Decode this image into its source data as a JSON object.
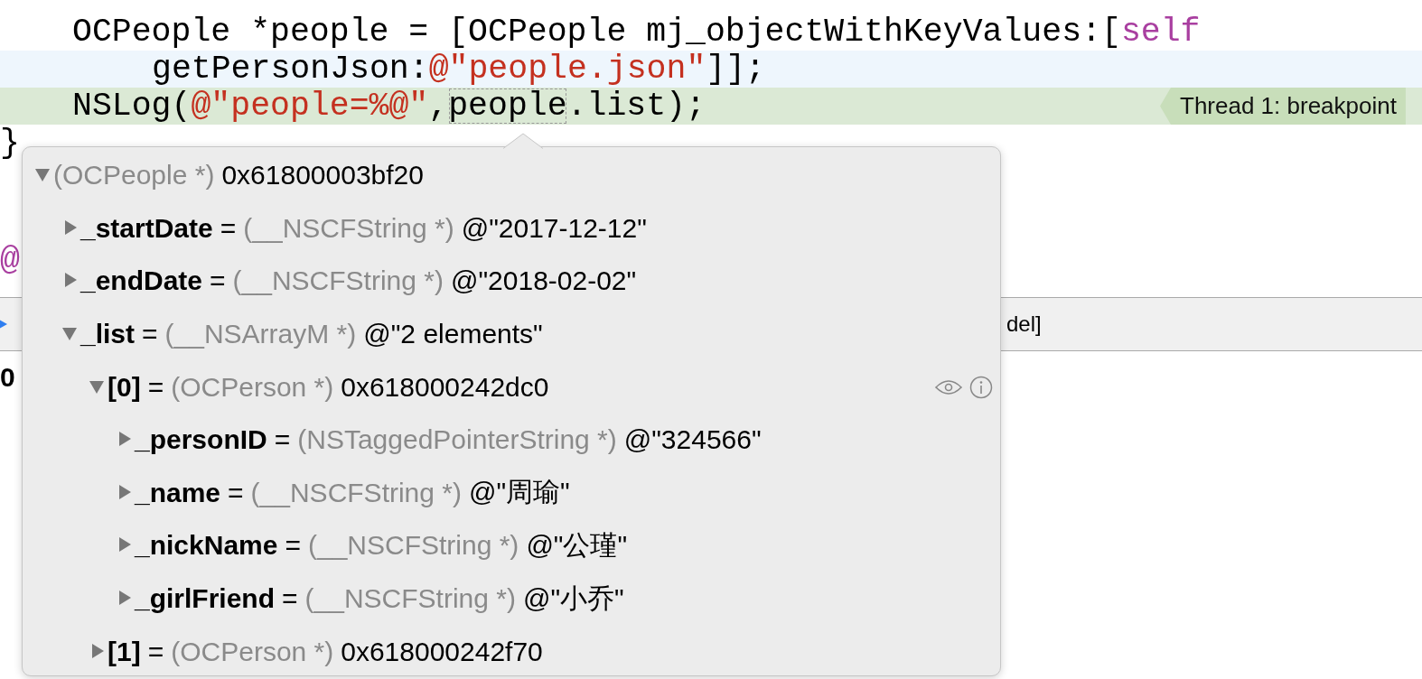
{
  "code_lines": [
    {
      "kind": "statement",
      "hovered": false,
      "current": false,
      "tokens": [
        {
          "kind": "plain",
          "text": "OCPeople *people = [OCPeople mj_objectWithKeyValues:["
        },
        {
          "kind": "keyword",
          "text": "self"
        }
      ]
    },
    {
      "kind": "continuation",
      "hovered": true,
      "current": false,
      "tokens": [
        {
          "kind": "plain",
          "text": "getPersonJson:"
        },
        {
          "kind": "string",
          "text": "@\"people.json\""
        },
        {
          "kind": "plain",
          "text": "]];"
        }
      ]
    },
    {
      "kind": "statement",
      "hovered": false,
      "current": true,
      "tokens": [
        {
          "kind": "plain",
          "text": "NSLog("
        },
        {
          "kind": "string",
          "text": "@\"people=%@\"",
          "punctuation": ","
        },
        {
          "kind": "inspected",
          "text": "people"
        },
        {
          "kind": "plain",
          "text": ".list);"
        }
      ],
      "annotation": "Thread 1: breakpoint"
    },
    {
      "kind": "closing",
      "hovered": false,
      "current": false,
      "tokens": [
        {
          "kind": "plain",
          "text": "}"
        }
      ]
    }
  ],
  "hidden_code": {
    "text": "@"
  },
  "debug_bar": {
    "text": "del]"
  },
  "console": {
    "text": "0"
  },
  "popup": {
    "root": {
      "type": "(OCPeople *)",
      "value": "0x61800003bf20",
      "expanded": true,
      "hovered": false,
      "children": [
        {
          "name": "_startDate",
          "separator": "=",
          "type": "(__NSCFString *)",
          "value": "@\"2017-12-12\"",
          "expanded": false,
          "hovered": false
        },
        {
          "name": "_endDate",
          "separator": "=",
          "type": "(__NSCFString *)",
          "value": "@\"2018-02-02\"",
          "expanded": false,
          "hovered": false
        },
        {
          "name": "_list",
          "separator": "=",
          "type": "(__NSArrayM *)",
          "value": "@\"2 elements\"",
          "expanded": true,
          "hovered": false,
          "children": [
            {
              "name": "[0]",
              "separator": "=",
              "type": "(OCPerson *)",
              "value": "0x618000242dc0",
              "expanded": true,
              "hovered": true,
              "children": [
                {
                  "name": "_personID",
                  "separator": "=",
                  "type": "(NSTaggedPointerString *)",
                  "value": "@\"324566\"",
                  "expanded": false,
                  "hovered": false
                },
                {
                  "name": "_name",
                  "separator": "=",
                  "type": "(__NSCFString *)",
                  "value": "@\"周瑜\"",
                  "expanded": false,
                  "hovered": false
                },
                {
                  "name": "_nickName",
                  "separator": "=",
                  "type": "(__NSCFString *)",
                  "value": "@\"公瑾\"",
                  "expanded": false,
                  "hovered": false
                },
                {
                  "name": "_girlFriend",
                  "separator": "=",
                  "type": "(__NSCFString *)",
                  "value": "@\"小乔\"",
                  "expanded": false,
                  "hovered": false
                }
              ]
            },
            {
              "name": "[1]",
              "separator": "=",
              "type": "(OCPerson *)",
              "value": "0x618000242f70",
              "expanded": false,
              "hovered": false
            }
          ]
        }
      ]
    }
  }
}
